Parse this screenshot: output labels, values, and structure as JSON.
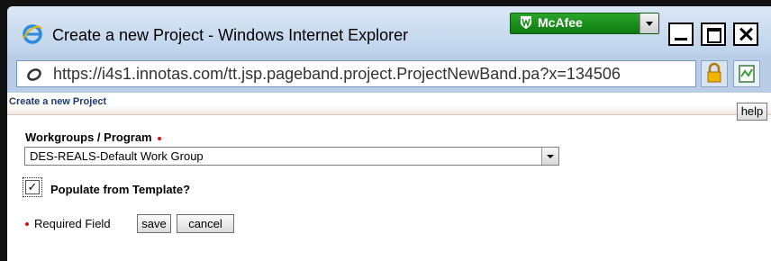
{
  "window": {
    "title": "Create a new Project - Windows Internet Explorer",
    "toolbar_badge": "McAfee"
  },
  "address_bar": {
    "url": "https://i4s1.innotas.com/tt.jsp.pageband.project.ProjectNewBand.pa?x=134506"
  },
  "page": {
    "title": "Create a new Project",
    "help_label": "help",
    "workgroup_label": "Workgroups / Program",
    "workgroup_value": "DES-REALS-Default Work Group",
    "populate_label": "Populate from Template?",
    "populate_checked": "✓",
    "required_text": "Required Field",
    "save_label": "save",
    "cancel_label": "cancel"
  },
  "colors": {
    "required_marker": "#d81010",
    "mcafee_green": "#1c8f1e",
    "title_link": "#1f3a6e"
  }
}
